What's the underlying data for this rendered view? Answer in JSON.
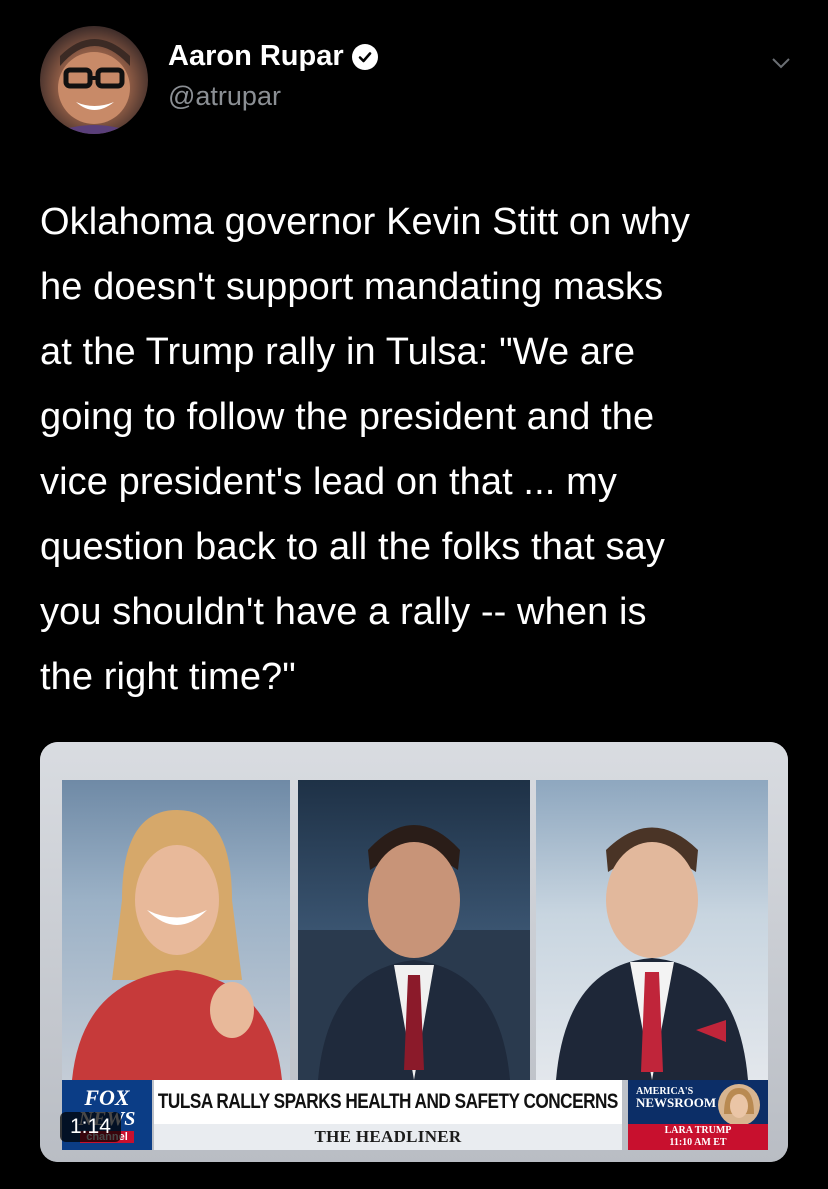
{
  "author": {
    "display_name": "Aaron Rupar",
    "handle": "@atrupar",
    "verified": true,
    "avatar_icon": "avatar-photo",
    "verified_icon": "verified-badge-icon",
    "menu_icon": "chevron-down-icon"
  },
  "tweet": {
    "text": "Oklahoma governor Kevin Stitt on why\nhe doesn't support mandating masks\nat the Trump rally in Tulsa: \"We are\ngoing to follow the president and the\nvice president's lead on that ... my\nquestion back to all the folks that say\nyou shouldn't have a rally -- when is\nthe right time?\""
  },
  "video": {
    "duration": "1:14",
    "lower_third": {
      "network_line1": "FOX",
      "network_line2": "NEWS",
      "network_line3": "channel",
      "headline": "TULSA RALLY SPARKS HEALTH AND SAFETY CONCERNS",
      "segment": "THE HEADLINER",
      "show_small": "AMERICA'S",
      "show_big": "NEWSROOM",
      "guest_name": "LARA TRUMP",
      "time": "11:10 AM ET"
    }
  },
  "colors": {
    "background": "#000000",
    "text": "#ffffff",
    "secondary_text": "#8b8f94",
    "fox_blue": "#0b3d86",
    "fox_red": "#c8102e"
  }
}
